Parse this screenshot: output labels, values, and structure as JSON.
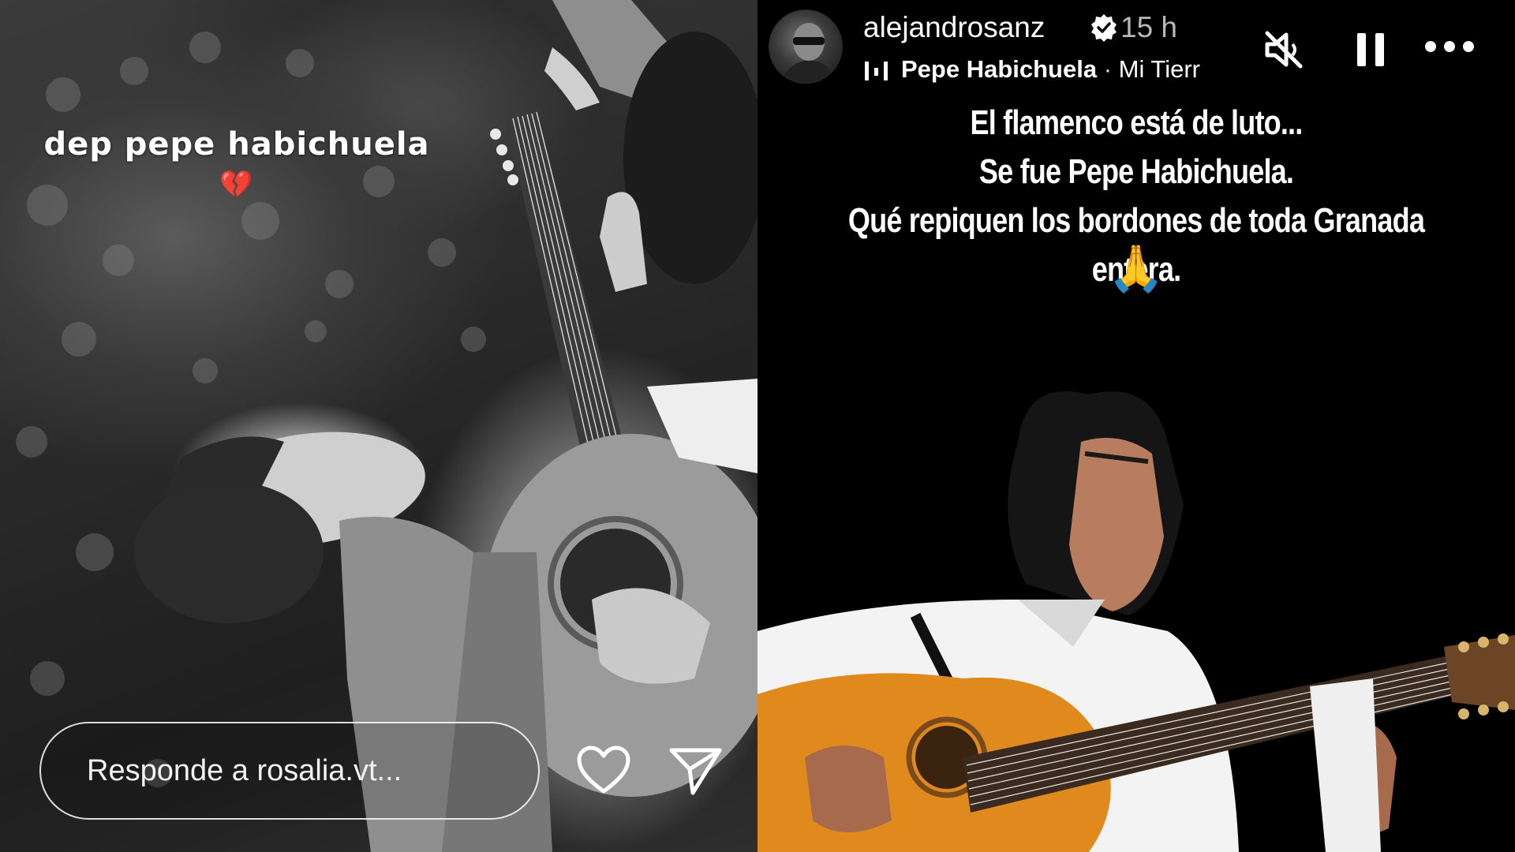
{
  "left_story": {
    "caption": "dep pepe habichuela",
    "caption_emoji": "💔",
    "reply_placeholder": "Responde a rosalia.vt...",
    "icons": {
      "like": "heart-icon",
      "send": "send-paper-plane-icon"
    }
  },
  "right_story": {
    "username": "alejandrosanz",
    "verified": true,
    "time_ago": "15 h",
    "song_title": "Pepe Habichuela",
    "song_separator": " · ",
    "song_subtitle": "Mi Tierr",
    "text_lines": [
      "El flamenco está de luto...",
      "Se fue Pepe Habichuela.",
      "Qué repiquen los bordones de toda Granada entera."
    ],
    "emoji": "🙏",
    "icons": {
      "mute": "speaker-muted-icon",
      "pause": "pause-icon",
      "more": "more-options-icon",
      "music": "music-bars-icon"
    }
  },
  "colors": {
    "verified_badge": "#ffffff",
    "guitar_body": "#e08a1e",
    "shirt": "#f4f4f4"
  }
}
